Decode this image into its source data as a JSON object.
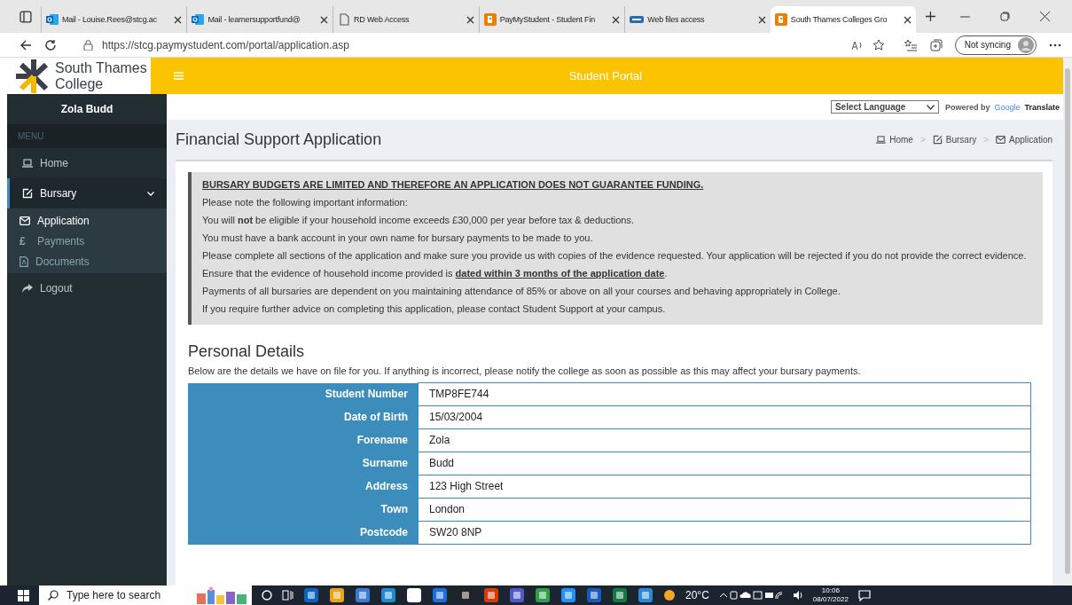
{
  "browser": {
    "tabs": [
      {
        "kind": "mail",
        "title": "Mail - Louise.Rees@stcg.ac",
        "selected": false
      },
      {
        "kind": "mail",
        "title": "Mail - learnersupportfund@",
        "selected": false
      },
      {
        "kind": "page",
        "title": "RD Web Access",
        "selected": false
      },
      {
        "kind": "portal",
        "title": "PayMyStudent - Student Fin",
        "selected": false
      },
      {
        "kind": "drive",
        "title": "Web files access",
        "selected": false
      },
      {
        "kind": "portal",
        "title": "South Thames Colleges Gro",
        "selected": true
      }
    ],
    "url": "https://stcg.paymystudent.com/portal/application.asp",
    "sync": "Not syncing"
  },
  "header": {
    "logo_line_1": "South Thames",
    "logo_line_2": "College",
    "title": "Student Portal"
  },
  "translate": {
    "select": "Select Language",
    "powered": "Powered by",
    "brand": "Google",
    "product": "Translate"
  },
  "sidebar": {
    "user": "Zola Budd",
    "menu_label": "MENU",
    "items": [
      {
        "kind": "laptop",
        "label": "Home",
        "selected": false
      },
      {
        "kind": "edit",
        "label": "Bursary",
        "selected": false,
        "expanded": true,
        "children": [
          {
            "kind": "envelope",
            "label": "Application",
            "selected": true
          },
          {
            "kind": "glyph",
            "glyph": "£",
            "label": "Payments",
            "selected": false
          },
          {
            "kind": "file",
            "label": "Documents",
            "selected": false
          }
        ]
      },
      {
        "kind": "share",
        "label": "Logout",
        "selected": false
      }
    ]
  },
  "page_title": "Financial Support Application",
  "breadcrumb": [
    {
      "kind": "laptop",
      "label": "Home"
    },
    {
      "kind": "edit",
      "separator": ">",
      "label": "Bursary"
    },
    {
      "kind": "envelope",
      "separator": ">",
      "label": "Application"
    }
  ],
  "notice": [
    {
      "kind": "heading",
      "text": "BURSARY BUDGETS ARE LIMITED AND THEREFORE AN APPLICATION DOES NOT GUARANTEE FUNDING."
    },
    {
      "kind": "line",
      "text": "Please note the following important information:"
    },
    {
      "kind": "line",
      "text": "You will **not** be eligible if your household income exceeds £30,000 per year before tax & deductions."
    },
    {
      "kind": "line",
      "text": "You must have a bank account in your own name for bursary payments to be made to you."
    },
    {
      "kind": "line",
      "text": "Please complete all sections of the application and make sure you provide us with copies of the evidence requested. Your application will be rejected if you do not provide the correct evidence."
    },
    {
      "kind": "underlined",
      "text": "Ensure that the evidence of household income provided is **dated within 3 months of the application date**."
    },
    {
      "kind": "line",
      "text": "Payments of all bursaries are dependent on you maintaining attendance of 85% or above on all your courses and behaving appropriately in College."
    },
    {
      "kind": "line",
      "text": "If you require further advice on completing this application, please contact Student Support at your campus."
    }
  ],
  "personal": {
    "title": "Personal Details",
    "intro": "Below are the details we have on file for you. If anything is incorrect, please notify the college as soon as possible as this may affect your bursary payments.",
    "rows": [
      {
        "label": "Student Number",
        "value": "TMP8FE744"
      },
      {
        "label": "Date of Birth",
        "value": "15/03/2004"
      },
      {
        "label": "Forename",
        "value": "Zola"
      },
      {
        "label": "Surname",
        "value": "Budd"
      },
      {
        "label": "Address",
        "value": "123 High Street"
      },
      {
        "label": "Town",
        "value": "London"
      },
      {
        "label": "Postcode",
        "value": "SW20 8NP"
      }
    ]
  },
  "taskbar": {
    "search": "Type here to search",
    "weather": "20°C",
    "time": "10:06",
    "date": "08/07/2022"
  }
}
